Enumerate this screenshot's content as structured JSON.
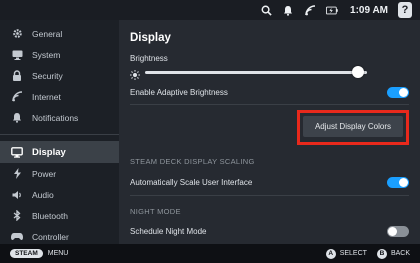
{
  "status_bar": {
    "time": "1:09 AM",
    "help_label": "?",
    "icons": [
      "search-icon",
      "notification-bell-icon",
      "signal-icon",
      "battery-icon"
    ]
  },
  "sidebar": {
    "items": [
      {
        "label": "General",
        "icon": "gear-icon"
      },
      {
        "label": "System",
        "icon": "monitor-icon"
      },
      {
        "label": "Security",
        "icon": "lock-icon"
      },
      {
        "label": "Internet",
        "icon": "wifi-icon"
      },
      {
        "label": "Notifications",
        "icon": "bell-icon"
      },
      {
        "label": "Display",
        "icon": "display-icon",
        "active": true
      },
      {
        "label": "Power",
        "icon": "lightning-icon"
      },
      {
        "label": "Audio",
        "icon": "speaker-icon"
      },
      {
        "label": "Bluetooth",
        "icon": "bluetooth-icon"
      },
      {
        "label": "Controller",
        "icon": "gamepad-icon"
      }
    ]
  },
  "main": {
    "title": "Display",
    "brightness": {
      "label": "Brightness",
      "value": 0.96
    },
    "adaptive_brightness": {
      "label": "Enable Adaptive Brightness",
      "enabled": true
    },
    "adjust_colors_button": "Adjust Display Colors",
    "scaling_section": "STEAM DECK DISPLAY SCALING",
    "auto_scale": {
      "label": "Automatically Scale User Interface",
      "enabled": true
    },
    "night_mode_section": "NIGHT MODE",
    "schedule_night_mode": {
      "label": "Schedule Night Mode",
      "enabled": false
    }
  },
  "footer": {
    "steam_label": "STEAM",
    "menu_label": "MENU",
    "select_button": "A",
    "select_label": "SELECT",
    "back_button": "B",
    "back_label": "BACK"
  },
  "colors": {
    "accent": "#1a9fff",
    "highlight_border": "#e8291c",
    "sidebar_bg": "#1c2026",
    "main_bg": "#262a31"
  }
}
